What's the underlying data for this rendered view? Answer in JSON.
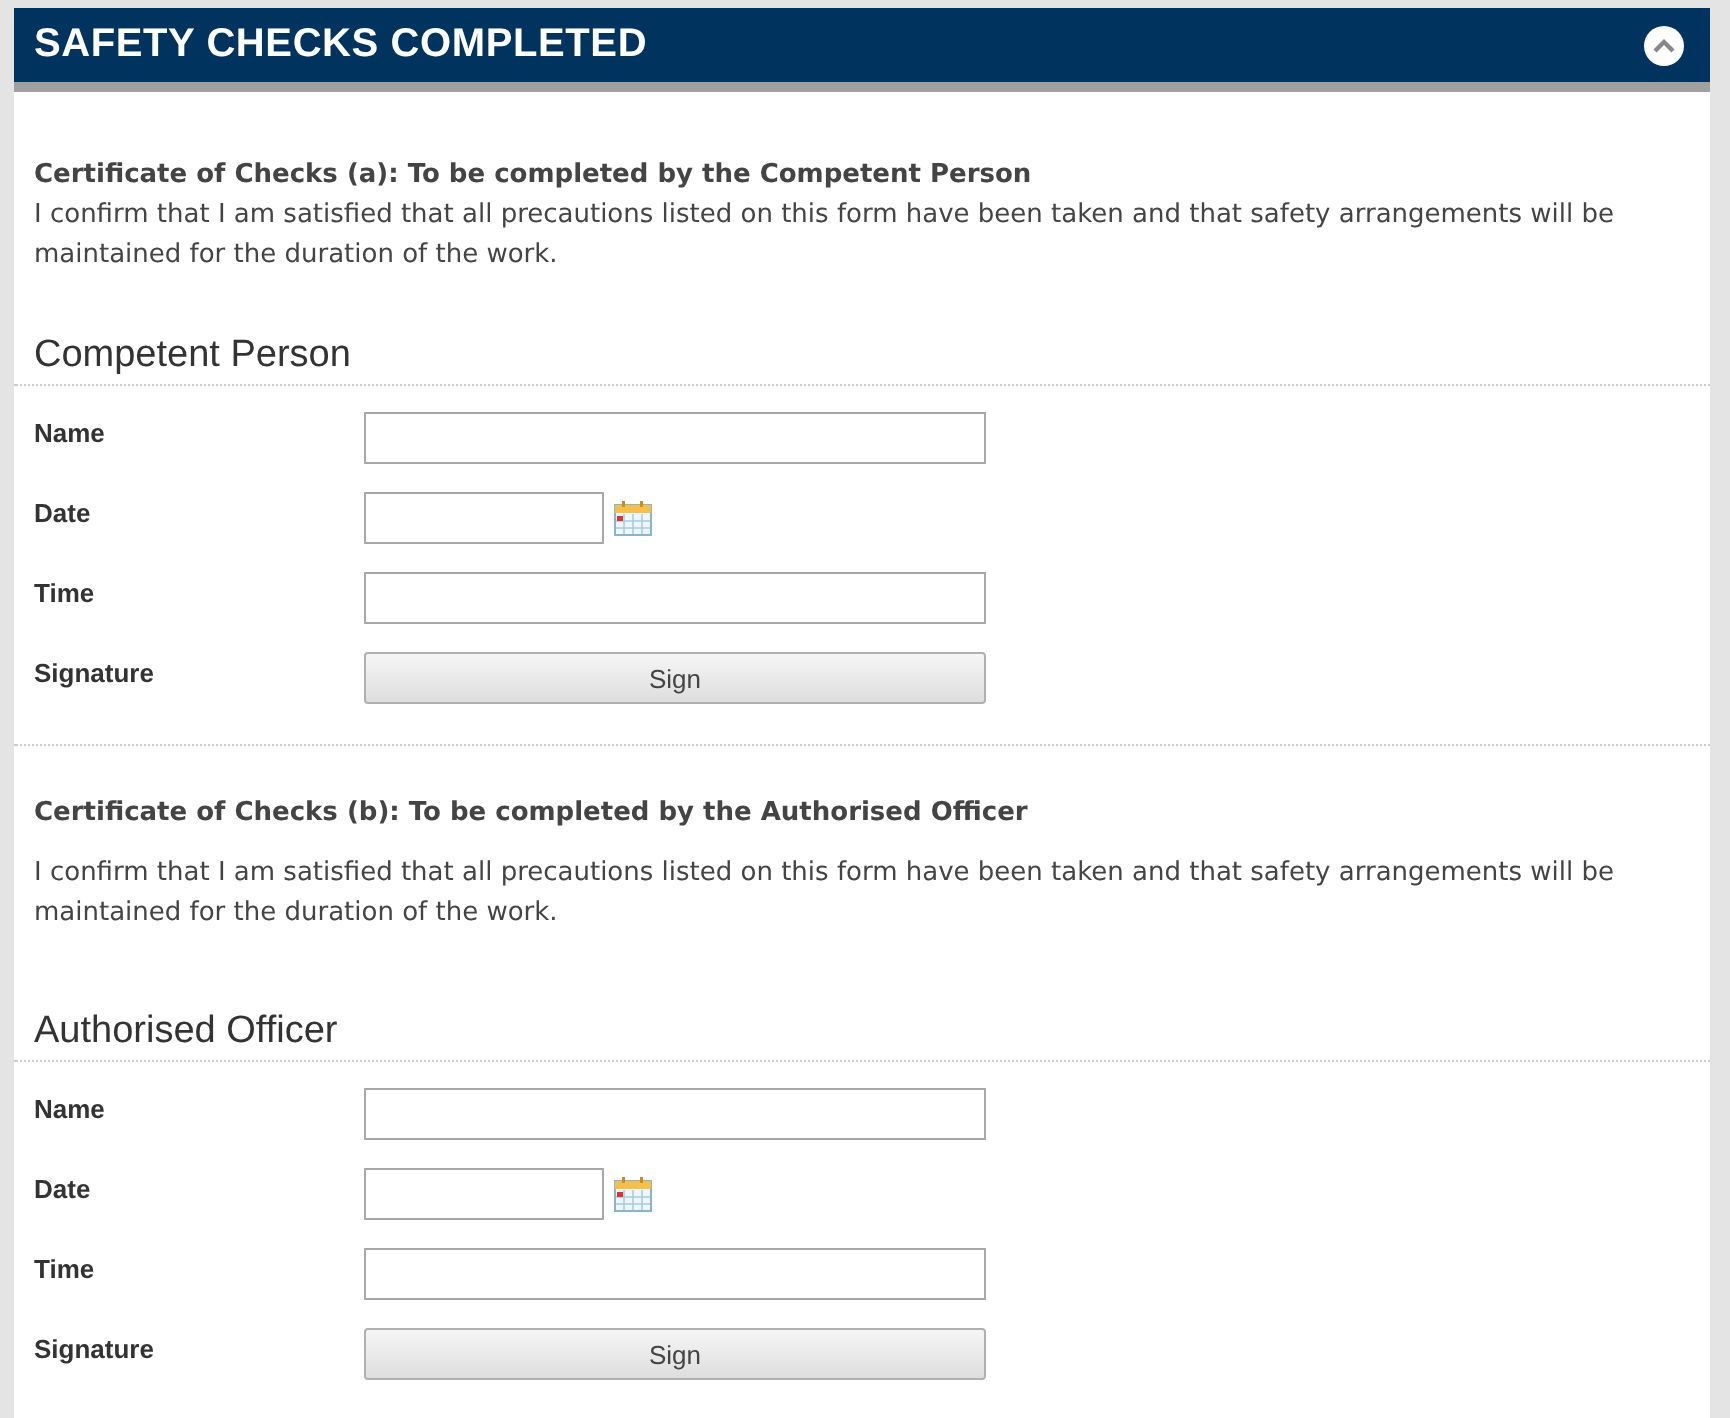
{
  "panel": {
    "title": "SAFETY CHECKS COMPLETED",
    "expanded": true
  },
  "sections": [
    {
      "certificate_title": "Certificate of Checks (a): To be completed by the Competent Person",
      "certificate_text": "I confirm that I am satisfied that all precautions listed on this form have been taken and that safety arrangements will be maintained for the duration of the work.",
      "heading": "Competent Person",
      "fields": [
        {
          "label": "Name",
          "kind": "text"
        },
        {
          "label": "Date",
          "kind": "date"
        },
        {
          "label": "Time",
          "kind": "text"
        },
        {
          "label": "Signature",
          "kind": "sign",
          "button": "Sign"
        }
      ]
    },
    {
      "certificate_title": "Certificate of Checks (b): To be completed by the Authorised Officer",
      "certificate_text": "I confirm that I am satisfied that all precautions listed on this form have been taken and that safety  arrangements will be maintained for the duration of the work.",
      "heading": "Authorised Officer",
      "fields": [
        {
          "label": "Name",
          "kind": "text"
        },
        {
          "label": "Date",
          "kind": "date"
        },
        {
          "label": "Time",
          "kind": "text"
        },
        {
          "label": "Signature",
          "kind": "sign",
          "button": "Sign"
        }
      ]
    }
  ]
}
